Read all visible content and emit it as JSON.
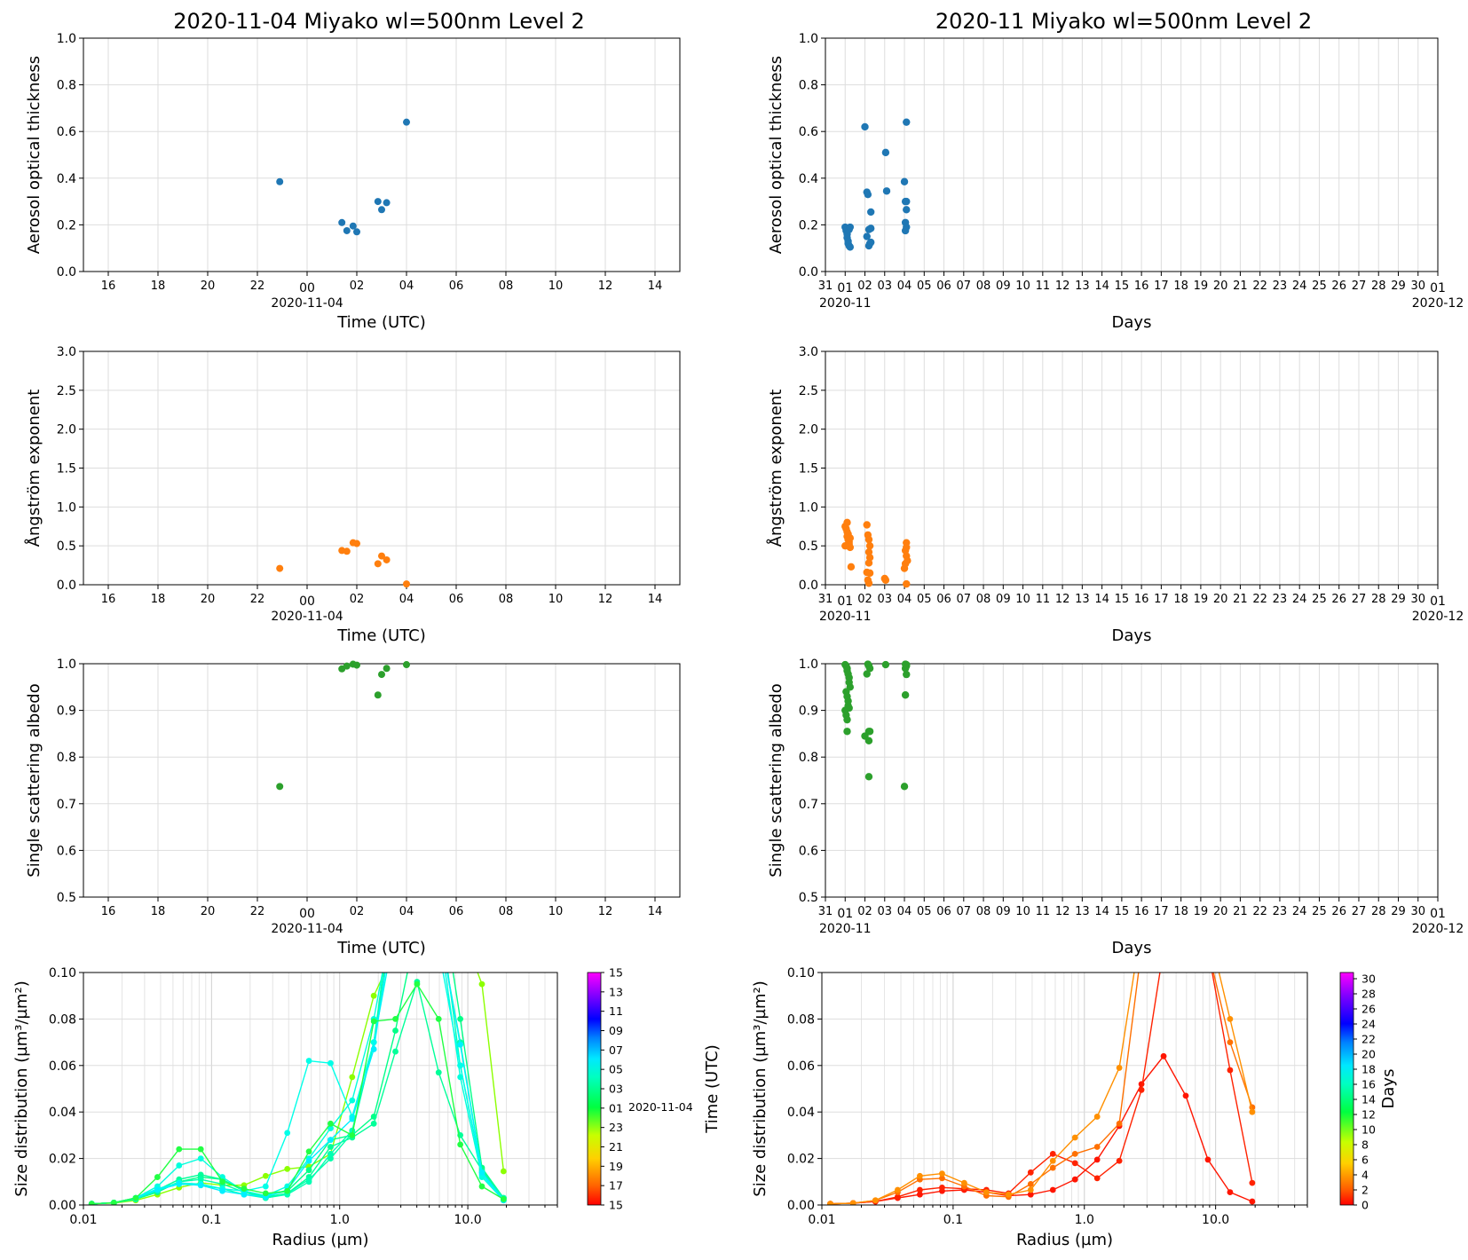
{
  "colors": {
    "aot": "#1f77b4",
    "angstrom": "#ff7f0e",
    "ssa": "#2ca02c",
    "grid": "#dddddd"
  },
  "daily": {
    "title": "2020-11-04  Miyako  wl=500nm  Level 2",
    "xlabel": "Time (UTC)",
    "date_label": "2020-11-04",
    "hour_ticks": [
      "16",
      "18",
      "20",
      "22",
      "00",
      "02",
      "04",
      "06",
      "08",
      "10",
      "12",
      "14"
    ]
  },
  "monthly": {
    "title": "2020-11  Miyako  wl=500nm  Level 2",
    "xlabel": "Days",
    "day_ticks": [
      "31",
      "01",
      "02",
      "03",
      "04",
      "05",
      "06",
      "07",
      "08",
      "09",
      "10",
      "11",
      "12",
      "13",
      "14",
      "15",
      "16",
      "17",
      "18",
      "19",
      "20",
      "21",
      "22",
      "23",
      "24",
      "25",
      "26",
      "27",
      "28",
      "29",
      "30",
      "01"
    ],
    "start_label": "2020-11",
    "end_label": "2020-12"
  },
  "size_dist": {
    "ylabel": "Size distribution (µm³/µm²)",
    "xlabel": "Radius (µm)",
    "xtick_labels": [
      "0.01",
      "0.1",
      "1.0",
      "10.0"
    ],
    "left_colorbar": {
      "label": "Time (UTC)",
      "tick_labels": [
        "15",
        "13",
        "11",
        "09",
        "07",
        "05",
        "03",
        "01",
        "23",
        "21",
        "19",
        "17",
        "15"
      ],
      "date_label": "2020-11-04"
    },
    "right_colorbar": {
      "label": "Days",
      "tick_labels": [
        "0",
        "2",
        "4",
        "6",
        "8",
        "10",
        "12",
        "14",
        "16",
        "18",
        "20",
        "22",
        "24",
        "26",
        "28",
        "30"
      ]
    }
  },
  "chart_data": [
    {
      "type": "scatter",
      "panel": "daily-aot",
      "title": "2020-11-04  Miyako  wl=500nm  Level 2",
      "xlabel": "Time (UTC)",
      "ylabel": "Aerosol optical thickness",
      "xlim_hours": [
        -9,
        15
      ],
      "ylim": [
        0.0,
        1.0
      ],
      "yticks": [
        "0.0",
        "0.2",
        "0.4",
        "0.6",
        "0.8",
        "1.0"
      ],
      "x_hours": [
        -1.1,
        1.4,
        1.6,
        1.85,
        2.0,
        2.85,
        3.0,
        3.2,
        4.0
      ],
      "y": [
        0.385,
        0.21,
        0.175,
        0.195,
        0.17,
        0.3,
        0.265,
        0.295,
        0.64
      ]
    },
    {
      "type": "scatter",
      "panel": "monthly-aot",
      "title": "2020-11  Miyako  wl=500nm  Level 2",
      "xlabel": "Days",
      "ylabel": "Aerosol optical thickness",
      "xlim_days": [
        -1,
        30
      ],
      "ylim": [
        0.0,
        1.0
      ],
      "yticks": [
        "0.0",
        "0.2",
        "0.4",
        "0.6",
        "0.8",
        "1.0"
      ],
      "x_days": [
        0.0,
        0.05,
        0.1,
        0.1,
        0.15,
        0.15,
        0.2,
        0.2,
        0.25,
        0.25,
        1.0,
        1.1,
        1.15,
        1.2,
        1.25,
        1.3,
        1.2,
        1.1,
        1.3,
        1.3,
        2.05,
        2.1,
        3.0,
        3.05,
        3.1,
        3.05,
        3.1,
        3.05,
        3.1,
        3.1
      ],
      "y": [
        0.19,
        0.175,
        0.16,
        0.145,
        0.13,
        0.12,
        0.11,
        0.18,
        0.105,
        0.19,
        0.62,
        0.34,
        0.33,
        0.11,
        0.12,
        0.255,
        0.18,
        0.15,
        0.185,
        0.125,
        0.51,
        0.345,
        0.385,
        0.3,
        0.265,
        0.21,
        0.19,
        0.175,
        0.3,
        0.64
      ]
    },
    {
      "type": "scatter",
      "panel": "daily-angstrom",
      "xlabel": "Time (UTC)",
      "ylabel": "Ångström exponent",
      "xlim_hours": [
        -9,
        15
      ],
      "ylim": [
        0.0,
        3.0
      ],
      "yticks": [
        "0.0",
        "0.5",
        "1.0",
        "1.5",
        "2.0",
        "2.5",
        "3.0"
      ],
      "x_hours": [
        -1.1,
        1.4,
        1.6,
        1.85,
        2.0,
        2.85,
        3.0,
        3.2,
        4.0
      ],
      "y": [
        0.21,
        0.44,
        0.43,
        0.54,
        0.53,
        0.27,
        0.37,
        0.32,
        0.01
      ]
    },
    {
      "type": "scatter",
      "panel": "monthly-angstrom",
      "xlabel": "Days",
      "ylabel": "Ångström exponent",
      "xlim_days": [
        -1,
        30
      ],
      "ylim": [
        0.0,
        3.0
      ],
      "yticks": [
        "0.0",
        "0.5",
        "1.0",
        "1.5",
        "2.0",
        "2.5",
        "3.0"
      ],
      "x_days": [
        0.0,
        0.05,
        0.1,
        0.1,
        0.15,
        0.2,
        0.2,
        0.25,
        0.1,
        0.0,
        0.15,
        0.25,
        0.3,
        1.1,
        1.15,
        1.2,
        1.25,
        1.2,
        1.25,
        1.2,
        1.1,
        1.25,
        1.15,
        1.2,
        2.0,
        2.05,
        3.0,
        3.05,
        3.1,
        3.05,
        3.1,
        3.1,
        3.15,
        3.1
      ],
      "y": [
        0.75,
        0.72,
        0.68,
        0.62,
        0.58,
        0.55,
        0.52,
        0.48,
        0.8,
        0.5,
        0.65,
        0.6,
        0.23,
        0.77,
        0.64,
        0.58,
        0.5,
        0.42,
        0.35,
        0.28,
        0.16,
        0.15,
        0.06,
        0.02,
        0.08,
        0.06,
        0.21,
        0.27,
        0.37,
        0.44,
        0.54,
        0.48,
        0.31,
        0.01
      ]
    },
    {
      "type": "scatter",
      "panel": "daily-ssa",
      "xlabel": "Time (UTC)",
      "ylabel": "Single scattering albedo",
      "xlim_hours": [
        -9,
        15
      ],
      "ylim": [
        0.5,
        1.0
      ],
      "yticks": [
        "0.5",
        "0.6",
        "0.7",
        "0.8",
        "0.9",
        "1.0"
      ],
      "x_hours": [
        -1.1,
        1.4,
        1.6,
        1.85,
        2.0,
        2.85,
        3.0,
        3.2,
        4.0
      ],
      "y": [
        0.737,
        0.989,
        0.995,
        0.999,
        0.997,
        0.933,
        0.977,
        0.99,
        0.998
      ]
    },
    {
      "type": "scatter",
      "panel": "monthly-ssa",
      "xlabel": "Days",
      "ylabel": "Single scattering albedo",
      "xlim_days": [
        -1,
        30
      ],
      "ylim": [
        0.5,
        1.0
      ],
      "yticks": [
        "0.5",
        "0.6",
        "0.7",
        "0.8",
        "0.9",
        "1.0"
      ],
      "x_days": [
        0.0,
        0.05,
        0.1,
        0.1,
        0.15,
        0.2,
        0.2,
        0.25,
        0.05,
        0.1,
        0.15,
        0.15,
        0.2,
        0.0,
        0.05,
        0.1,
        0.1,
        1.0,
        1.15,
        1.2,
        1.25,
        1.1,
        1.2,
        1.25,
        1.2,
        1.2,
        2.05,
        3.0,
        3.05,
        3.1,
        3.05,
        3.1,
        3.1,
        3.05
      ],
      "y": [
        0.998,
        0.995,
        0.99,
        0.985,
        0.978,
        0.97,
        0.96,
        0.95,
        0.94,
        0.93,
        0.92,
        0.91,
        0.905,
        0.9,
        0.89,
        0.88,
        0.855,
        0.845,
        0.999,
        0.995,
        0.99,
        0.978,
        0.855,
        0.855,
        0.835,
        0.758,
        0.998,
        0.737,
        0.933,
        0.977,
        0.99,
        0.995,
        0.998,
        0.999
      ]
    },
    {
      "type": "line",
      "panel": "daily-size-distribution",
      "xscale": "log",
      "xlim": [
        0.01,
        50
      ],
      "ylim": [
        0.0,
        0.1
      ],
      "xlabel": "Radius (µm)",
      "ylabel": "Size distribution (µm³/µm²)",
      "yticks": [
        "0.00",
        "0.02",
        "0.04",
        "0.06",
        "0.08",
        "0.10"
      ],
      "radius": [
        0.0116,
        0.0173,
        0.0256,
        0.0378,
        0.0558,
        0.0824,
        0.1215,
        0.1793,
        0.2644,
        0.39,
        0.5754,
        0.8486,
        1.2517,
        1.8462,
        2.723,
        4.0162,
        5.9238,
        8.7372,
        12.887,
        19.008
      ],
      "series": [
        {
          "time_utc": -1.1,
          "color": "#8cff00",
          "values": [
            0.0005,
            0.0008,
            0.002,
            0.0045,
            0.0075,
            0.0095,
            0.0085,
            0.0085,
            0.0125,
            0.0155,
            0.0165,
            0.022,
            0.055,
            0.09,
            0.11,
            0.13,
            0.16,
            0.12,
            0.095,
            0.0145
          ]
        },
        {
          "time_utc": 1.4,
          "color": "#00ff88",
          "values": [
            0.0005,
            0.001,
            0.0025,
            0.0055,
            0.01,
            0.012,
            0.011,
            0.006,
            0.004,
            0.006,
            0.015,
            0.028,
            0.03,
            0.038,
            0.075,
            0.12,
            0.14,
            0.08,
            0.016,
            0.003
          ]
        },
        {
          "time_utc": 1.6,
          "color": "#00ff99",
          "values": [
            0.0005,
            0.001,
            0.003,
            0.0065,
            0.011,
            0.013,
            0.011,
            0.006,
            0.0035,
            0.005,
            0.012,
            0.025,
            0.029,
            0.035,
            0.066,
            0.096,
            0.057,
            0.03,
            0.015,
            0.003
          ]
        },
        {
          "time_utc": 1.85,
          "color": "#00ffaa",
          "values": [
            0.0005,
            0.001,
            0.0025,
            0.006,
            0.01,
            0.011,
            0.009,
            0.0055,
            0.003,
            0.005,
            0.011,
            0.02,
            0.031,
            0.07,
            0.13,
            0.15,
            0.12,
            0.07,
            0.014,
            0.003
          ]
        },
        {
          "time_utc": 2.0,
          "color": "#00ffb3",
          "values": [
            0.0005,
            0.001,
            0.003,
            0.0065,
            0.009,
            0.0085,
            0.007,
            0.0045,
            0.003,
            0.0045,
            0.01,
            0.022,
            0.032,
            0.07,
            0.14,
            0.17,
            0.13,
            0.06,
            0.014,
            0.003
          ]
        },
        {
          "time_utc": 2.85,
          "color": "#00ffdd",
          "values": [
            0.0005,
            0.001,
            0.003,
            0.008,
            0.017,
            0.02,
            0.012,
            0.006,
            0.004,
            0.008,
            0.02,
            0.033,
            0.045,
            0.08,
            0.13,
            0.14,
            0.12,
            0.055,
            0.012,
            0.002
          ]
        },
        {
          "time_utc": 3.0,
          "color": "#00ffe8",
          "values": [
            0.0005,
            0.001,
            0.003,
            0.007,
            0.0095,
            0.009,
            0.007,
            0.006,
            0.008,
            0.031,
            0.062,
            0.061,
            0.038,
            0.07,
            0.12,
            0.14,
            0.11,
            0.06,
            0.013,
            0.002
          ]
        },
        {
          "time_utc": 3.2,
          "color": "#00f0ff",
          "values": [
            0.0005,
            0.001,
            0.003,
            0.0065,
            0.009,
            0.0085,
            0.006,
            0.0045,
            0.0035,
            0.0065,
            0.019,
            0.028,
            0.037,
            0.067,
            0.13,
            0.16,
            0.12,
            0.069,
            0.014,
            0.002
          ]
        },
        {
          "time_utc": 4.0,
          "color": "#22ff44",
          "values": [
            0.0005,
            0.001,
            0.003,
            0.012,
            0.024,
            0.024,
            0.01,
            0.007,
            0.005,
            0.006,
            0.023,
            0.035,
            0.03,
            0.079,
            0.08,
            0.095,
            0.08,
            0.026,
            0.008,
            0.0025
          ]
        }
      ]
    },
    {
      "type": "line",
      "panel": "monthly-size-distribution",
      "xscale": "log",
      "xlim": [
        0.01,
        50
      ],
      "ylim": [
        0.0,
        0.1
      ],
      "xlabel": "Radius (µm)",
      "ylabel": "Size distribution (µm³/µm²)",
      "yticks": [
        "0.00",
        "0.02",
        "0.04",
        "0.06",
        "0.08",
        "0.10"
      ],
      "radius": [
        0.0116,
        0.0173,
        0.0256,
        0.0378,
        0.0558,
        0.0824,
        0.1215,
        0.1793,
        0.2644,
        0.39,
        0.5754,
        0.8486,
        1.2517,
        1.8462,
        2.723,
        4.0162,
        5.9238,
        8.7372,
        12.887,
        19.008
      ],
      "series": [
        {
          "day": 1,
          "color": "#ff1500",
          "values": [
            0.0005,
            0.0008,
            0.0015,
            0.003,
            0.0045,
            0.006,
            0.0065,
            0.0055,
            0.004,
            0.0045,
            0.0065,
            0.011,
            0.0195,
            0.034,
            0.052,
            0.064,
            0.047,
            0.0195,
            0.0055,
            0.0015
          ]
        },
        {
          "day": 2,
          "color": "#ff2200",
          "values": [
            0.0005,
            0.0008,
            0.0015,
            0.0035,
            0.0065,
            0.0075,
            0.007,
            0.0065,
            0.005,
            0.014,
            0.022,
            0.018,
            0.0115,
            0.019,
            0.0495,
            0.11,
            0.17,
            0.11,
            0.058,
            0.0095
          ]
        },
        {
          "day": 3,
          "color": "#ff7000",
          "values": [
            0.0005,
            0.0008,
            0.002,
            0.0055,
            0.011,
            0.0115,
            0.008,
            0.004,
            0.0035,
            0.009,
            0.016,
            0.022,
            0.025,
            0.035,
            0.11,
            0.16,
            0.15,
            0.11,
            0.07,
            0.042
          ]
        },
        {
          "day": 4,
          "color": "#ff9000",
          "values": [
            0.0005,
            0.0008,
            0.002,
            0.0065,
            0.0125,
            0.0135,
            0.0095,
            0.0055,
            0.0045,
            0.0065,
            0.019,
            0.029,
            0.038,
            0.059,
            0.12,
            0.16,
            0.15,
            0.12,
            0.08,
            0.04
          ]
        }
      ]
    }
  ]
}
